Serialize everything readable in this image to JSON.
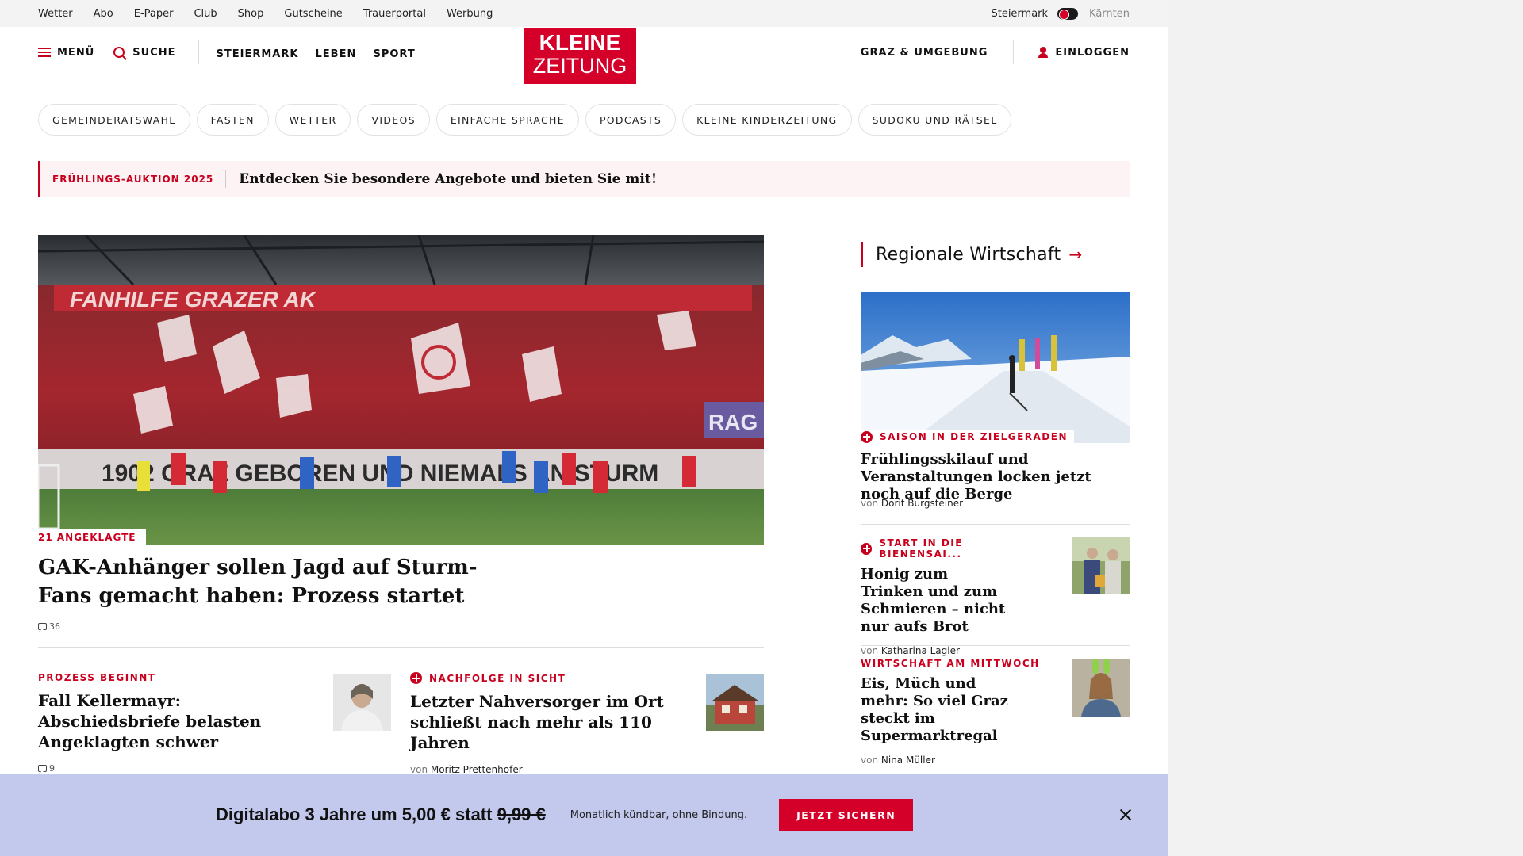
{
  "topbar": {
    "links": [
      "Wetter",
      "Abo",
      "E-Paper",
      "Club",
      "Shop",
      "Gutscheine",
      "Trauerportal",
      "Werbung"
    ],
    "region_active": "Steiermark",
    "region_inactive": "Kärnten"
  },
  "header": {
    "menu_label": "MENÜ",
    "search_label": "SUCHE",
    "nav": [
      "STEIERMARK",
      "LEBEN",
      "SPORT"
    ],
    "logo_line1": "KLEINE",
    "logo_line2": "ZEITUNG",
    "local_label": "GRAZ & UMGEBUNG",
    "login_label": "EINLOGGEN"
  },
  "chips": [
    "GEMEINDERATSWAHL",
    "FASTEN",
    "WETTER",
    "VIDEOS",
    "EINFACHE SPRACHE",
    "PODCASTS",
    "KLEINE KINDERZEITUNG",
    "SUDOKU UND RÄTSEL"
  ],
  "promo": {
    "label": "FRÜHLINGS-AUKTION 2025",
    "text": "Entdecken Sie besondere Angebote und bieten Sie mit!"
  },
  "hero": {
    "label": "21 ANGEKLAGTE",
    "title": "GAK-Anhänger sollen Jagd auf Sturm-Fans gemacht haben: Prozess startet",
    "comments": "36"
  },
  "cards": [
    {
      "label": "PROZESS BEGINNT",
      "title": "Fall Kellermayr: Abschiedsbriefe belasten Angeklagten schwer",
      "comments": "9"
    },
    {
      "label": "NACHFOLGE IN SICHT",
      "title": "Letzter Nahversorger im Ort schließt nach mehr als 110 Jahren",
      "by_prefix": "von",
      "author": "Moritz Prettenhofer"
    }
  ],
  "sidebar": {
    "heading": "Regionale Wirtschaft",
    "arrow": "→",
    "items": [
      {
        "label": "SAISON IN DER ZIELGERADEN",
        "title": "Frühlingsskilauf und Veranstaltungen locken jetzt noch auf die Berge",
        "by_prefix": "von",
        "author": "Dorit Burgsteiner"
      },
      {
        "label": "START IN DIE BIENENSAI...",
        "title": "Honig zum Trinken und zum Schmieren – nicht nur aufs Brot",
        "by_prefix": "von",
        "author": "Katharina Lagler"
      },
      {
        "label": "WIRTSCHAFT AM MITTWOCH",
        "title": "Eis, Müch und mehr: So viel Graz steckt im Supermarktregal",
        "by_prefix": "von",
        "author": "Nina Müller"
      }
    ]
  },
  "banner": {
    "headline": "Digitalabo 3 Jahre um 5,00 € statt",
    "old_price": "9,99 €",
    "sub": "Monatlich kündbar, ohne Bindung.",
    "button": "JETZT SICHERN"
  },
  "colors": {
    "brand_red": "#d4002a",
    "banner_bg": "#c3c8ed",
    "promo_bg": "#fdf3f4"
  }
}
